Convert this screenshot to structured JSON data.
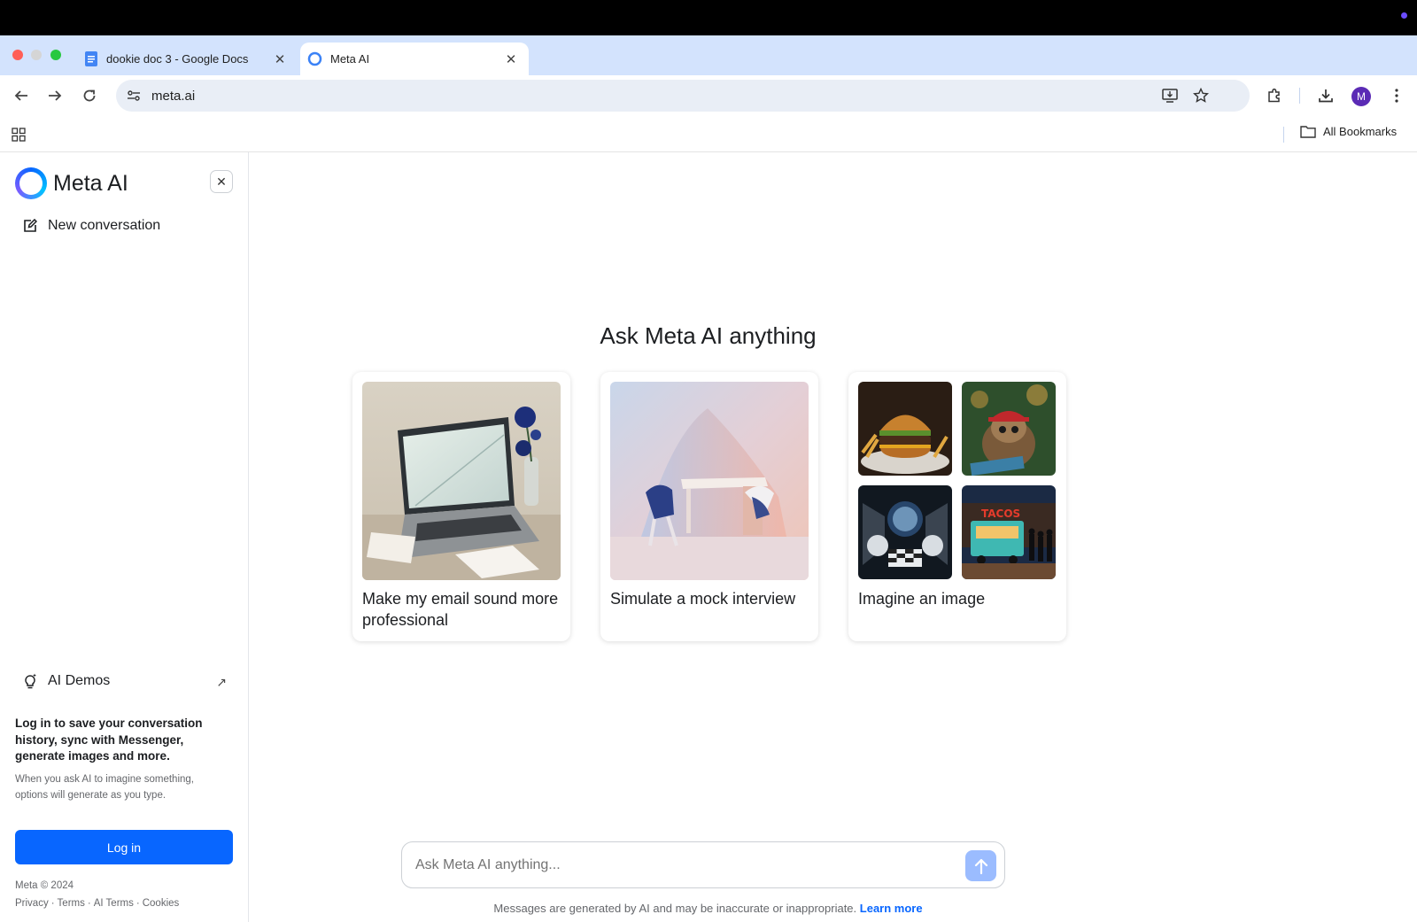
{
  "browser": {
    "tabs": [
      {
        "title": "dookie doc 3 - Google Docs",
        "icon": "google-docs-icon",
        "active": false
      },
      {
        "title": "Meta AI",
        "icon": "meta-ai-icon",
        "active": true
      }
    ],
    "url": "meta.ai",
    "profile_initial": "M",
    "bookmarks_label": "All Bookmarks",
    "colors": {
      "tabstrip": "#d3e3fd",
      "omnibox": "#e9eef6"
    }
  },
  "sidebar": {
    "brand": "Meta AI",
    "new_conversation": "New conversation",
    "ai_demos": "AI Demos",
    "login_message": "Log in to save your conversation history, sync with Messenger, generate images and more.",
    "login_sub": "When you ask AI to imagine something, options will generate as you type.",
    "login_button": "Log in",
    "copyright": "Meta © 2024",
    "footer_links": [
      "Privacy",
      "Terms",
      "AI Terms",
      "Cookies"
    ]
  },
  "main": {
    "heading": "Ask Meta AI anything",
    "cards": [
      {
        "label": "Make my email sound more professional",
        "image": "laptop-with-rose"
      },
      {
        "label": "Simulate a mock interview",
        "image": "desk-and-chairs"
      },
      {
        "label": "Imagine an image",
        "images": [
          "burger-and-fries",
          "sloth-in-cap",
          "astronauts-playing-chess",
          "taco-truck-at-night"
        ]
      }
    ],
    "composer_placeholder": "Ask Meta AI anything...",
    "disclaimer": "Messages are generated by AI and may be inaccurate or inappropriate.",
    "learn_more": "Learn more",
    "accent_color": "#0866ff"
  }
}
